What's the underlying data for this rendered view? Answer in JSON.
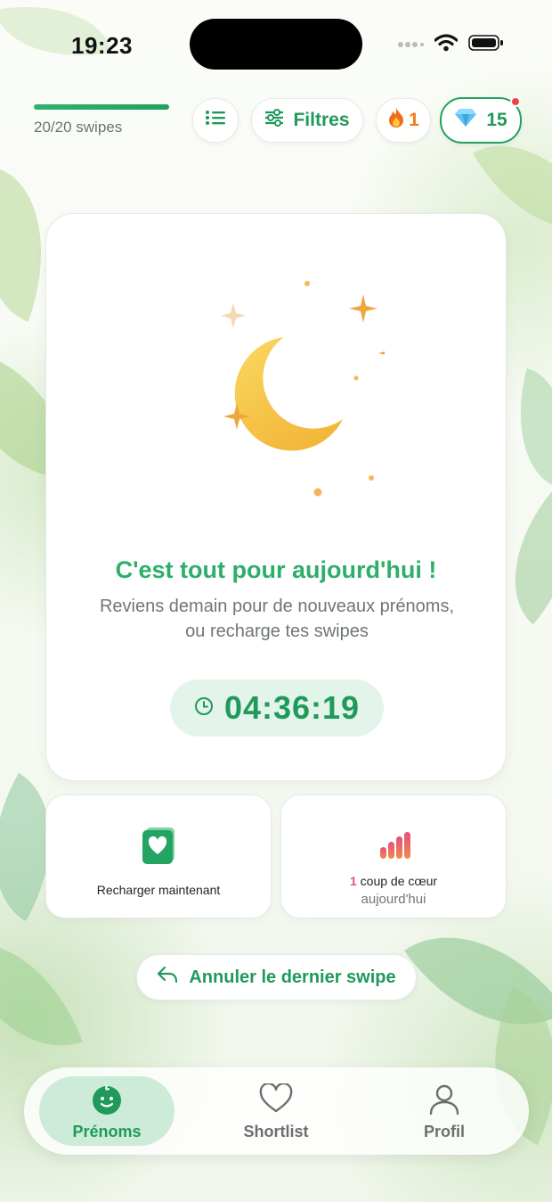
{
  "status_bar": {
    "time": "19:23"
  },
  "header": {
    "progress": 1.0,
    "swipes_label": "20/20 swipes",
    "list_icon": "list-icon",
    "filters_label": "Filtres",
    "streak_count": "1",
    "gems_count": "15"
  },
  "card": {
    "illustration": "moon-icon",
    "title": "C'est tout pour aujourd'hui !",
    "subtitle_line1": "Reviens demain pour de nouveaux prénoms,",
    "subtitle_line2": "ou recharge tes swipes",
    "timer": "04:36:19"
  },
  "actions": {
    "recharge_label": "Recharger maintenant",
    "likes_count": "1",
    "likes_label_line1": "coup de cœur",
    "likes_label_line2": "aujourd'hui",
    "undo_label": "Annuler le dernier swipe"
  },
  "tabs": [
    {
      "label": "Prénoms",
      "icon": "baby-icon",
      "active": true
    },
    {
      "label": "Shortlist",
      "icon": "heart-icon",
      "active": false
    },
    {
      "label": "Profil",
      "icon": "person-icon",
      "active": false
    }
  ],
  "colors": {
    "accent": "#22a160",
    "accent_light": "#e3f4ea",
    "moon": "#f6c33d",
    "star": "#eea73b",
    "notification": "#ef4444"
  }
}
